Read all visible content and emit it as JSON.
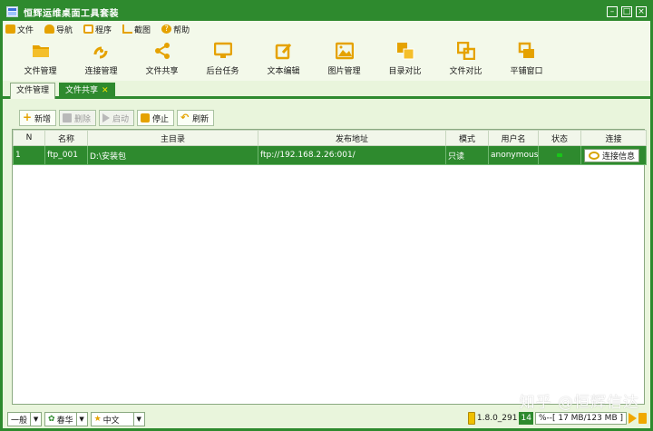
{
  "window": {
    "title": "恒辉运维桌面工具套装"
  },
  "menu": [
    {
      "label": "文件",
      "icon": "folder-icon",
      "color": "#e5a200"
    },
    {
      "label": "导航",
      "icon": "car-icon",
      "color": "#e5a200"
    },
    {
      "label": "程序",
      "icon": "program-icon",
      "color": "#e5a200"
    },
    {
      "label": "截图",
      "icon": "crop-icon",
      "color": "#e5a200"
    },
    {
      "label": "帮助",
      "icon": "help-icon",
      "color": "#e5a200"
    }
  ],
  "toolbar": [
    {
      "label": "文件管理",
      "icon": "folder-open-icon"
    },
    {
      "label": "连接管理",
      "icon": "connection-icon"
    },
    {
      "label": "文件共享",
      "icon": "share-icon"
    },
    {
      "label": "后台任务",
      "icon": "monitor-icon"
    },
    {
      "label": "文本编辑",
      "icon": "edit-icon"
    },
    {
      "label": "图片管理",
      "icon": "image-icon"
    },
    {
      "label": "目录对比",
      "icon": "dir-compare-icon"
    },
    {
      "label": "文件对比",
      "icon": "file-compare-icon"
    },
    {
      "label": "平铺窗口",
      "icon": "tile-windows-icon"
    }
  ],
  "tabs": [
    {
      "label": "文件管理",
      "active": false
    },
    {
      "label": "文件共享",
      "active": true
    }
  ],
  "actions": [
    {
      "label": "新增",
      "enabled": true
    },
    {
      "label": "删除",
      "enabled": false
    },
    {
      "label": "启动",
      "enabled": false
    },
    {
      "label": "停止",
      "enabled": true
    },
    {
      "label": "刷新",
      "enabled": true
    }
  ],
  "table": {
    "columns": [
      "N",
      "名称",
      "主目录",
      "发布地址",
      "模式",
      "用户名",
      "状态",
      "连接"
    ],
    "rows": [
      {
        "n": "1",
        "name": "ftp_001",
        "dir": "D:\\安装包",
        "addr": "ftp://192.168.2.26:001/",
        "mode": "只读",
        "user": "anonymous",
        "status": "running",
        "conn_label": "连接信息"
      }
    ]
  },
  "statusbar": {
    "combo1": "一般",
    "combo2": "春华",
    "combo3": "中文",
    "version": "1.8.0_291",
    "mem_pct": "14",
    "mem_text": "%--[ 17 MB/123 MB ]"
  },
  "watermark": "知乎 @恒辉信达",
  "colors": {
    "primary": "#2e8a2e",
    "accent": "#e5a200",
    "status_ok": "#18c618"
  }
}
